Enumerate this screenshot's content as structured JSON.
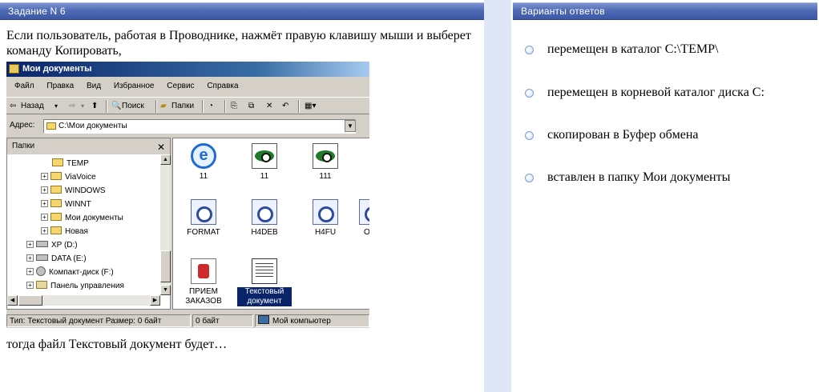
{
  "left_panel": {
    "header": "Задание N 6",
    "question_intro": "Если пользователь, работая в Проводнике, нажмёт правую клавишу мыши и выберет команду Копировать,",
    "question_outro": "тогда файл Текстовый документ будет…"
  },
  "right_panel": {
    "header": "Варианты ответов",
    "options": [
      "перемещен в каталог C:\\TEMP\\",
      "перемещен в корневой каталог диска С:",
      "скопирован в Буфер обмена",
      "вставлен в папку Мои документы"
    ]
  },
  "explorer": {
    "title": "Мои документы",
    "menu": [
      "Файл",
      "Правка",
      "Вид",
      "Избранное",
      "Сервис",
      "Справка"
    ],
    "toolbar": {
      "back": "Назад",
      "search": "Поиск",
      "folders": "Папки"
    },
    "address_label": "Адрес:",
    "address_value": "C:\\Мои документы",
    "folders_pane_title": "Папки",
    "tree": [
      {
        "label": "TEMP",
        "icon": "folder",
        "expander": ""
      },
      {
        "label": "ViaVoice",
        "icon": "folder",
        "expander": "+"
      },
      {
        "label": "WINDOWS",
        "icon": "folder",
        "expander": "+"
      },
      {
        "label": "WINNT",
        "icon": "folder",
        "expander": "+"
      },
      {
        "label": "Мои документы",
        "icon": "folder-open",
        "expander": "+"
      },
      {
        "label": "Новая",
        "icon": "folder",
        "expander": "+"
      },
      {
        "label": "XP (D:)",
        "icon": "drive",
        "expander": "+"
      },
      {
        "label": "DATA (E:)",
        "icon": "drive",
        "expander": "+"
      },
      {
        "label": "Компакт-диск (F:)",
        "icon": "cd-drive",
        "expander": "+"
      },
      {
        "label": "Панель управления",
        "icon": "control-panel",
        "expander": "+"
      }
    ],
    "files": [
      {
        "label": "11",
        "icon": "ie"
      },
      {
        "label": "11",
        "icon": "picture"
      },
      {
        "label": "111",
        "icon": "picture"
      },
      {
        "label": "FORMAT",
        "icon": "word-doc"
      },
      {
        "label": "H4DEB",
        "icon": "word-doc"
      },
      {
        "label": "H4FU",
        "icon": "word-doc"
      },
      {
        "label": "O",
        "icon": "word-doc"
      },
      {
        "label": "ПРИЕМ ЗАКАЗОВ",
        "icon": "pdf-doc"
      },
      {
        "label": "Текстовый документ",
        "icon": "text-doc",
        "selected": true
      }
    ],
    "status": {
      "info": "Тип: Текстовый документ Размер: 0 байт",
      "size": "0 байт",
      "location": "Мой компьютер"
    }
  }
}
